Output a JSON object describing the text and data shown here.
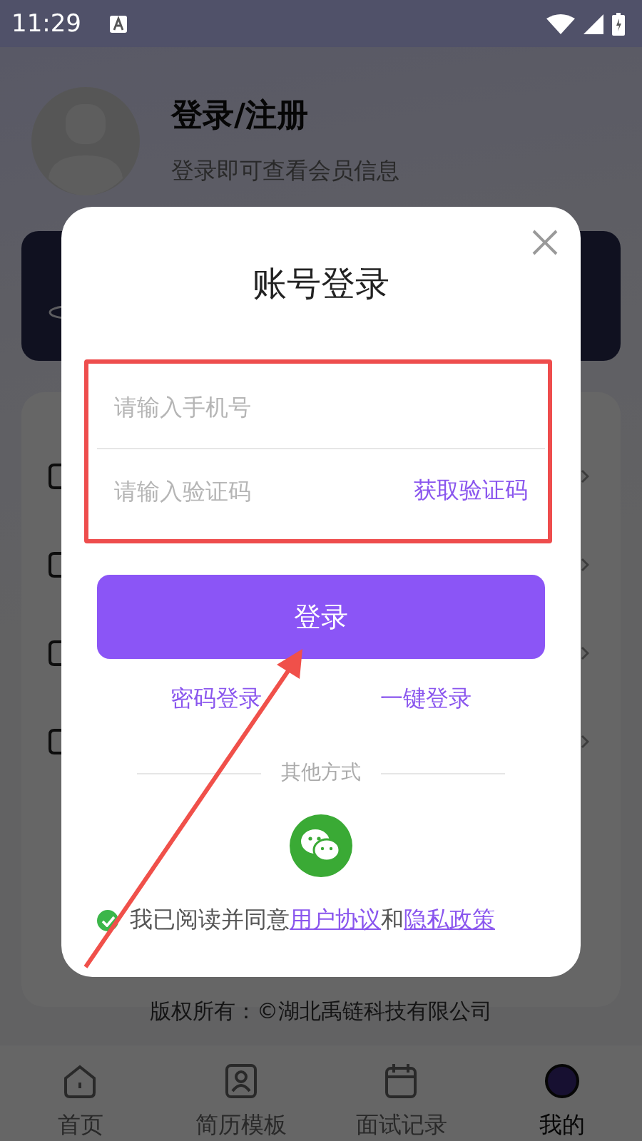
{
  "status_bar": {
    "time": "11:29"
  },
  "profile": {
    "title": "登录/注册",
    "subtitle": "登录即可查看会员信息"
  },
  "footer": {
    "copyright": "版权所有：©湖北禹链科技有限公司"
  },
  "bottom_nav": [
    {
      "label": "首页",
      "kind": "home",
      "selected": false
    },
    {
      "label": "简历模板",
      "kind": "resume",
      "selected": false
    },
    {
      "label": "面试记录",
      "kind": "calendar",
      "selected": false
    },
    {
      "label": "我的",
      "kind": "profile",
      "selected": true
    }
  ],
  "dialog": {
    "title": "账号登录",
    "phone_field": {
      "placeholder": "请输入手机号"
    },
    "code_field": {
      "placeholder": "请输入验证码"
    },
    "get_code": "获取验证码",
    "login_button": "登录",
    "alt_logins": [
      "密码登录",
      "一键登录"
    ],
    "divider": "其他方式",
    "agreement": {
      "checked": true,
      "parts": [
        {
          "kind": "text",
          "text": "我已阅读并同意"
        },
        {
          "kind": "link",
          "text": "用户协议"
        },
        {
          "kind": "text",
          "text": "和"
        },
        {
          "kind": "link",
          "text": "隐私政策"
        }
      ]
    }
  }
}
